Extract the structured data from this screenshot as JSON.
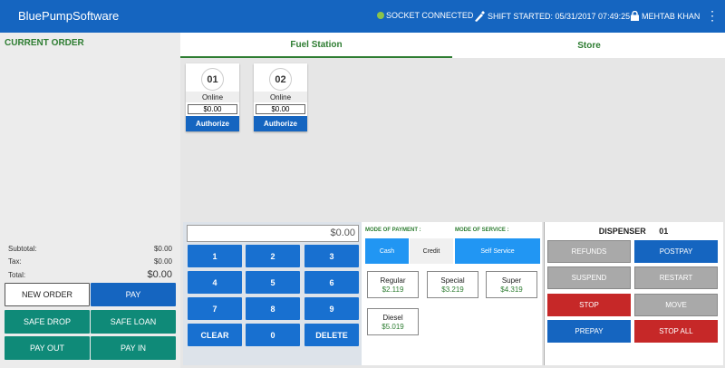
{
  "header": {
    "brand": "BluePumpSoftware",
    "socket_status": "SOCKET CONNECTED",
    "shift_status": "SHIFT STARTED: 05/31/2017 07:49:25",
    "user": "MEHTAB KHAN",
    "status_dot_color": "#8bc34a"
  },
  "order": {
    "title": "CURRENT ORDER",
    "subtotal_label": "Subtotal:",
    "subtotal": "$0.00",
    "tax_label": "Tax:",
    "tax": "$0.00",
    "total_label": "Total:",
    "total": "$0.00",
    "buttons": {
      "new_order": "NEW ORDER",
      "pay": "PAY",
      "safe_drop": "SAFE DROP",
      "safe_loan": "SAFE LOAN",
      "pay_out": "PAY OUT",
      "pay_in": "PAY IN"
    }
  },
  "tabs": [
    {
      "label": "Fuel Station",
      "active": true
    },
    {
      "label": "Store",
      "active": false
    }
  ],
  "pumps": [
    {
      "number": "01",
      "status": "Online",
      "amount": "$0.00",
      "action": "Authorize"
    },
    {
      "number": "02",
      "status": "Online",
      "amount": "$0.00",
      "action": "Authorize"
    }
  ],
  "keypad": {
    "display": "$0.00",
    "keys": [
      "1",
      "2",
      "3",
      "4",
      "5",
      "6",
      "7",
      "8",
      "9",
      "CLEAR",
      "0",
      "DELETE"
    ]
  },
  "payment": {
    "payment_label": "MODE OF PAYMENT :",
    "service_label": "MODE OF SERVICE :",
    "cash": "Cash",
    "credit": "Credit",
    "self_service": "Self Service",
    "grades": [
      {
        "name": "Regular",
        "price": "$2.119"
      },
      {
        "name": "Special",
        "price": "$3.219"
      },
      {
        "name": "Super",
        "price": "$4.319"
      },
      {
        "name": "Diesel",
        "price": "$5.019"
      }
    ]
  },
  "dispenser": {
    "title": "DISPENSER",
    "number": "01",
    "buttons": {
      "refunds": "REFUNDS",
      "postpay": "POSTPAY",
      "suspend": "SUSPEND",
      "restart": "RESTART",
      "stop": "STOP",
      "move": "MOVE",
      "prepay": "PREPAY",
      "stop_all": "STOP ALL"
    }
  },
  "colors": {
    "header": "#1565c0",
    "green": "#2e7d32",
    "teal": "#0f8a78",
    "red": "#c62828"
  }
}
